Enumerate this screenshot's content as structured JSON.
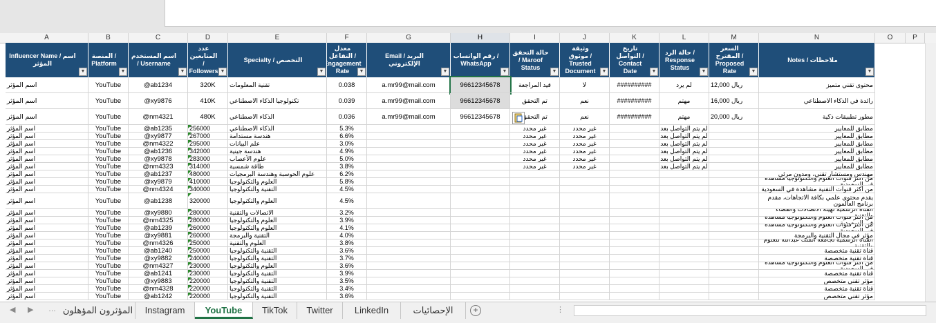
{
  "columns": [
    "A",
    "B",
    "C",
    "D",
    "E",
    "F",
    "G",
    "H",
    "I",
    "J",
    "K",
    "L",
    "M",
    "N",
    "O",
    "P"
  ],
  "headers": [
    "Influencer Name / اسم المؤثر",
    "المنصة / Platform",
    "اسم المستخدم / Username",
    "عدد المتابعين / Followers",
    "Specialty / التخصص",
    "معدل التفاعل / Engagement Rate",
    "Email / البريد الإلكتروني",
    "رقم الواتساب / WhatsApp",
    "حالة التحقق / Maroof Status",
    "وثيقة موثوق / Trusted Document",
    "تاريخ التواصل / Contact Date",
    "حالة الرد / Response Status",
    "السعر المقترح / Proposed Rate",
    "Notes / ملاحظات"
  ],
  "rows": [
    [
      "اسم المؤثر",
      "YouTube",
      "@ab1234",
      "320K",
      "تقنية المعلومات",
      "0.038",
      "a.mr99@mail.com",
      "96612345678",
      "قيد المراجعة",
      "لا",
      "##########",
      "لم يرد",
      "ريال 12,000",
      "محتوى تقني متميز"
    ],
    [
      "اسم المؤثر",
      "YouTube",
      "@xy9876",
      "410K",
      "تكنولوجيا الذكاء الاصطناعي",
      "0.039",
      "a.mr99@mail.com",
      "96612345678",
      "تم التحقق",
      "نعم",
      "##########",
      "مهتم",
      "ريال 16,000",
      "رائدة في الذكاء الاصطناعي"
    ],
    [
      "اسم المؤثر",
      "YouTube",
      "@nm4321",
      "480K",
      "الذكاء الاصطناعي",
      "0.036",
      "a.mr99@mail.com",
      "96612345678",
      "تم التحقق",
      "نعم",
      "##########",
      "مهتم",
      "ريال 20,000",
      "مطور تطبيقات ذكية"
    ],
    [
      "اسم المؤثر",
      "YouTube",
      "@ab1235",
      "256000",
      "الذكاء الاصطناعي",
      "5.3%",
      "",
      "",
      "غير محدد",
      "غير محدد",
      "",
      "لم يتم التواصل بعد",
      "",
      "مطابق للمعايير"
    ],
    [
      "اسم المؤثر",
      "YouTube",
      "@xy9877",
      "267000",
      "هندسة مستدامة",
      "6.6%",
      "",
      "",
      "غير محدد",
      "غير محدد",
      "",
      "لم يتم التواصل بعد",
      "",
      "مطابق للمعايير"
    ],
    [
      "اسم المؤثر",
      "YouTube",
      "@nm4322",
      "295000",
      "علم البيانات",
      "3.0%",
      "",
      "",
      "غير محدد",
      "غير محدد",
      "",
      "لم يتم التواصل بعد",
      "",
      "مطابق للمعايير"
    ],
    [
      "اسم المؤثر",
      "YouTube",
      "@ab1236",
      "342000",
      "هندسة جينية",
      "4.9%",
      "",
      "",
      "غير محدد",
      "غير محدد",
      "",
      "لم يتم التواصل بعد",
      "",
      "مطابق للمعايير"
    ],
    [
      "اسم المؤثر",
      "YouTube",
      "@xy9878",
      "283000",
      "علوم الأعصاب",
      "5.0%",
      "",
      "",
      "غير محدد",
      "غير محدد",
      "",
      "لم يتم التواصل بعد",
      "",
      "مطابق للمعايير"
    ],
    [
      "اسم المؤثر",
      "YouTube",
      "@nm4323",
      "314000",
      "طاقة شمسية",
      "3.8%",
      "",
      "",
      "غير محدد",
      "غير محدد",
      "",
      "لم يتم التواصل بعد",
      "",
      "مطابق للمعايير"
    ],
    [
      "اسم المؤثر",
      "YouTube",
      "@ab1237",
      "480000",
      "علوم الحوسبة وهندسة البرمجيات",
      "6.2%",
      "",
      "",
      "",
      "",
      "",
      "",
      "",
      "مهندس ومستشار تقني، ومدون مرئي"
    ],
    [
      "اسم المؤثر",
      "YouTube",
      "@xy9879",
      "410000",
      "العلوم والتكنولوجيا",
      "5.8%",
      "",
      "",
      "",
      "",
      "",
      "",
      "",
      "من أكثر قنوات العلوم والتكنولوجيا مشاهدة في السعودية"
    ],
    [
      "اسم المؤثر",
      "YouTube",
      "@nm4324",
      "340000",
      "التقنية والتكنولوجيا",
      "4.5%",
      "",
      "",
      "",
      "",
      "",
      "",
      "",
      "من أكثر قنوات التقنية مشاهدة في السعودية"
    ],
    [
      "اسم المؤثر",
      "YouTube",
      "@ab1238",
      "320000",
      "العلوم والتكنولوجيا",
      "4.5%",
      "",
      "",
      "",
      "",
      "",
      "",
      "",
      "يقدم محتوى علمي بكافة الاتجاهات، مقدم برنامج العالمون"
    ],
    [
      "اسم المؤثر",
      "YouTube",
      "@xy9880",
      "280000",
      "الاتصالات والتقنية",
      "3.2%",
      "",
      "",
      "",
      "",
      "",
      "",
      "",
      "القناة الرسمية لهيئة الاتصالات والفضاء والتقنية"
    ],
    [
      "اسم المؤثر",
      "YouTube",
      "@nm4325",
      "280000",
      "العلوم والتكنولوجيا",
      "3.9%",
      "",
      "",
      "",
      "",
      "",
      "",
      "",
      "من أكثر قنوات العلوم والتكنولوجيا مشاهدة في السعودية"
    ],
    [
      "اسم المؤثر",
      "YouTube",
      "@ab1239",
      "260000",
      "العلوم والتكنولوجيا",
      "4.1%",
      "",
      "",
      "",
      "",
      "",
      "",
      "",
      "من أكثر قنوات العلوم والتكنولوجيا مشاهدة في السعودية"
    ],
    [
      "اسم المؤثر",
      "YouTube",
      "@xy9881",
      "260000",
      "التقنية والبرمجة",
      "4.0%",
      "",
      "",
      "",
      "",
      "",
      "",
      "",
      "مؤثر في مجال التقنية والبرمجة"
    ],
    [
      "اسم المؤثر",
      "YouTube",
      "@nm4326",
      "250000",
      "العلوم والتقنية",
      "3.8%",
      "",
      "",
      "",
      "",
      "",
      "",
      "",
      "القناة الرسمية لجامعة الملك عبدالله للعلوم والتقنية"
    ],
    [
      "اسم المؤثر",
      "YouTube",
      "@ab1240",
      "250000",
      "التقنية والتكنولوجيا",
      "3.6%",
      "",
      "",
      "",
      "",
      "",
      "",
      "",
      "قناة تقنية متخصصة"
    ],
    [
      "اسم المؤثر",
      "YouTube",
      "@xy9882",
      "240000",
      "التقنية والتكنولوجيا",
      "3.7%",
      "",
      "",
      "",
      "",
      "",
      "",
      "",
      "قناة تقنية متخصصة"
    ],
    [
      "اسم المؤثر",
      "YouTube",
      "@nm4327",
      "230000",
      "العلوم والتكنولوجيا",
      "3.6%",
      "",
      "",
      "",
      "",
      "",
      "",
      "",
      "من أكثر قنوات العلوم والتكنولوجيا مشاهدة في السعودية"
    ],
    [
      "اسم المؤثر",
      "YouTube",
      "@ab1241",
      "230000",
      "التقنية والتكنولوجيا",
      "3.9%",
      "",
      "",
      "",
      "",
      "",
      "",
      "",
      "قناة تقنية متخصصة"
    ],
    [
      "اسم المؤثر",
      "YouTube",
      "@xy9883",
      "220000",
      "التقنية والتكنولوجيا",
      "3.5%",
      "",
      "",
      "",
      "",
      "",
      "",
      "",
      "مؤثر تقني متخصص"
    ],
    [
      "اسم المؤثر",
      "YouTube",
      "@nm4328",
      "220000",
      "التقنية والتكنولوجيا",
      "3.4%",
      "",
      "",
      "",
      "",
      "",
      "",
      "",
      "قناة تقنية متخصصة"
    ],
    [
      "اسم المؤثر",
      "YouTube",
      "@ab1242",
      "220000",
      "التقنية والتكنولوجيا",
      "3.6%",
      "",
      "",
      "",
      "",
      "",
      "",
      "",
      "مؤثر تقني متخصص"
    ]
  ],
  "sheet_tabs": [
    "المؤثرون المؤهلون",
    "Instagram",
    "YouTube",
    "TikTok",
    "Twitter",
    "LinkedIn",
    "الإحصائيات"
  ],
  "active_tab": "YouTube",
  "selected_column": "H",
  "colors": {
    "header_bg": "#1f4e79",
    "active_tab": "#217346",
    "selection": "#dcdcdc"
  }
}
